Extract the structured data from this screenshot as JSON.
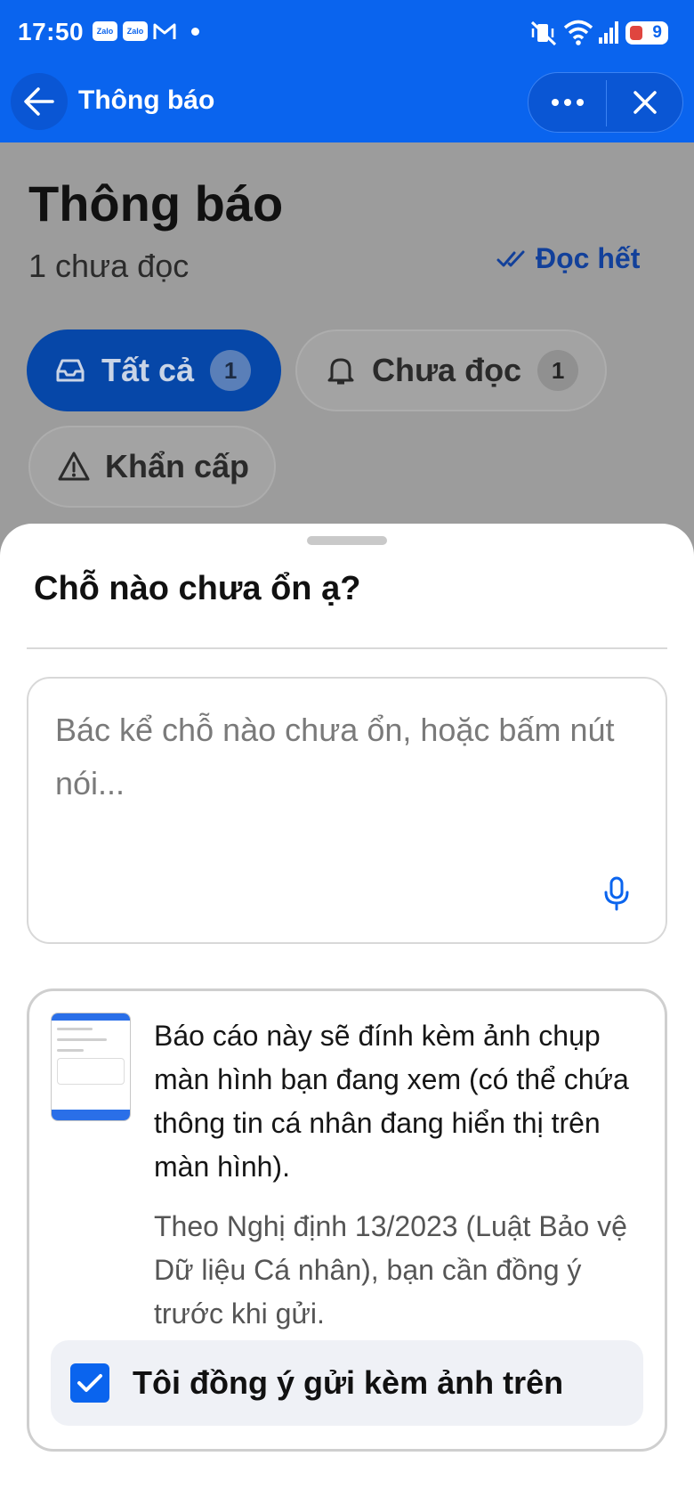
{
  "status_bar": {
    "time": "17:50",
    "apps": [
      "Zalo",
      "Zalo"
    ],
    "battery_level": "9"
  },
  "header": {
    "title": "Thông báo"
  },
  "page": {
    "title": "Thông báo",
    "unread_text": "1 chưa đọc",
    "read_all_label": "Đọc hết",
    "filters": [
      {
        "label": "Tất cả",
        "count": "1",
        "selected": true
      },
      {
        "label": "Chưa đọc",
        "count": "1",
        "selected": false
      },
      {
        "label": "Khẩn cấp",
        "selected": false
      }
    ]
  },
  "sheet": {
    "title": "Chỗ nào chưa ổn ạ?",
    "input_placeholder": "Bác kể chỗ nào chưa ổn, hoặc bấm nút nói...",
    "input_value": "",
    "consent_text": "Báo cáo này sẽ đính kèm ảnh chụp màn hình bạn đang xem (có thể chứa thông tin cá nhân đang hiển thị trên màn hình).",
    "legal_text": "Theo Nghị định 13/2023 (Luật Bảo vệ Dữ liệu Cá nhân), bạn cần đồng ý trước khi gửi.",
    "agree_label": "Tôi đồng ý gửi kèm ảnh trên",
    "agree_checked": true
  },
  "colors": {
    "brand": "#0a64ee",
    "selected_chip_dimmed": "#0647a8"
  }
}
